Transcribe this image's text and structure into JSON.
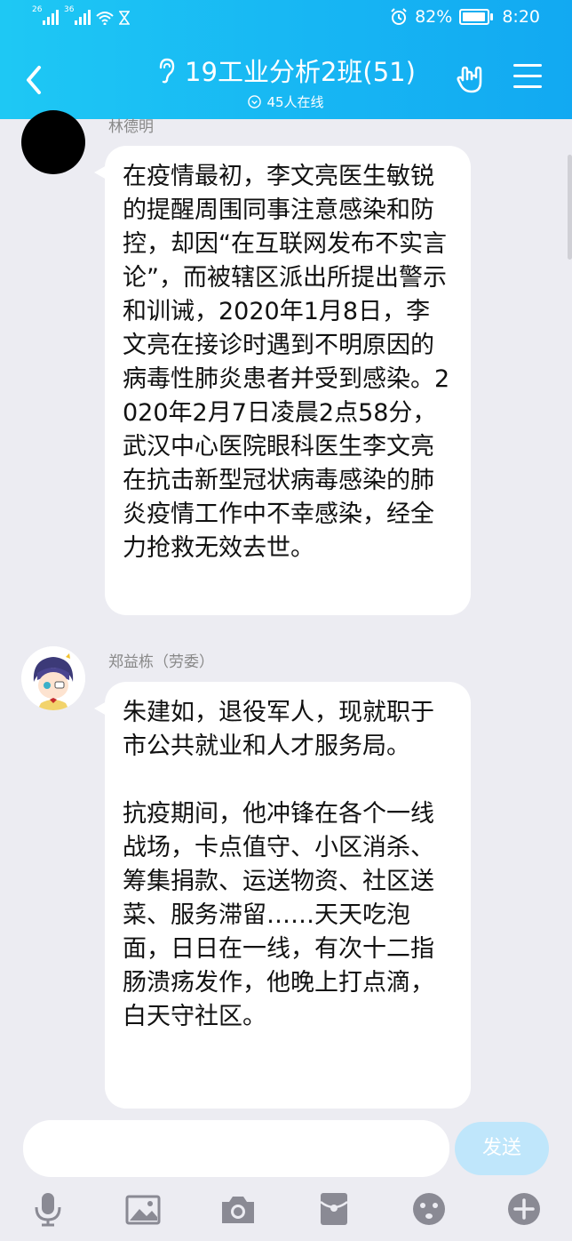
{
  "status": {
    "net1": "26",
    "net2": "36",
    "battery": "82%",
    "time": "8:20"
  },
  "header": {
    "title": "19工业分析2班(51)",
    "online": "45人在线"
  },
  "messages": [
    {
      "sender": "林德明",
      "text": "在疫情最初，李文亮医生敏锐的提醒周围同事注意感染和防控，却因“在互联网发布不实言论”，而被辖区派出所提出警示和训诫，2020年1月8日，李文亮在接诊时遇到不明原因的病毒性肺炎患者并受到感染。2020年2月7日凌晨2点58分，武汉中心医院眼科医生李文亮在抗击新型冠状病毒感染的肺炎疫情工作中不幸感染，经全力抢救无效去世。"
    },
    {
      "sender": "郑益栋（劳委）",
      "text": "朱建如，退役军人，现就职于市公共就业和人才服务局。\n\n抗疫期间，他冲锋在各个一线战场，卡点值守、小区消杀、筹集捐款、运送物资、社区送菜、服务滞留……天天吃泡面，日日在一线，有次十二指肠溃疡发作，他晚上打点滴，白天守社区。"
    }
  ],
  "input": {
    "send_label": "发送"
  },
  "toolbar": [
    "mic-icon",
    "image-icon",
    "camera-icon",
    "red-packet-icon",
    "emoji-icon",
    "plus-icon"
  ],
  "colors": {
    "header": "#17b6f3",
    "background": "#ececf2",
    "send_disabled": "#bfe6fb",
    "toolbar_icon": "#8a8a94"
  }
}
